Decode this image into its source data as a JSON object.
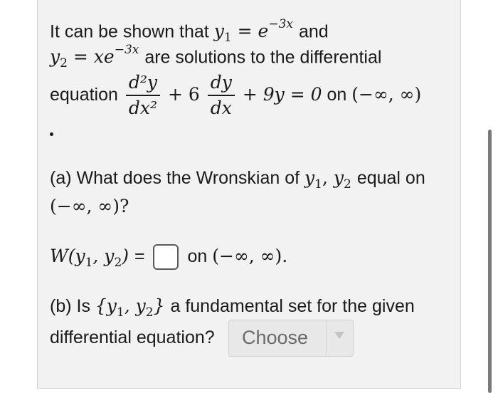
{
  "problem": {
    "intro_text": "It can be shown that",
    "y1_sym": "y",
    "y1_sub": "1",
    "equals": "=",
    "e_sym": "e",
    "exp1": "−3x",
    "and_text": "and",
    "y2_sym": "y",
    "y2_sub": "2",
    "xe_sym": "xe",
    "exp2": "−3x",
    "are_text": "are solutions to the differential",
    "equation_text": "equation",
    "frac1_num": "d²y",
    "frac1_den": "dx²",
    "plus6": "+ 6",
    "frac2_num": "dy",
    "frac2_den": "dx",
    "rest_eq": "+ 9y = 0",
    "on_text": "on",
    "interval": "(−∞, ∞)",
    "period": "."
  },
  "part_a": {
    "question_pre": "(a) What does the Wronskian of",
    "y_pair": "y",
    "s1": "1",
    "comma": ",",
    "s2": "2",
    "equal_on": "equal on",
    "interval": "(−∞, ∞)?",
    "w_label": "W(y",
    "w_mid": ", y",
    "w_close": ")",
    "eq_sign": "=",
    "on_text": "on",
    "interval2": "(−∞, ∞)."
  },
  "part_b": {
    "question_pre": "(b) Is",
    "set_open": "{y",
    "set_mid": ", y",
    "set_close": "}",
    "question_post": "a fundamental set for the given",
    "line2": "differential equation?",
    "select_value": "Choose"
  },
  "icons": {
    "select_arrow": "chevron-down-icon"
  }
}
